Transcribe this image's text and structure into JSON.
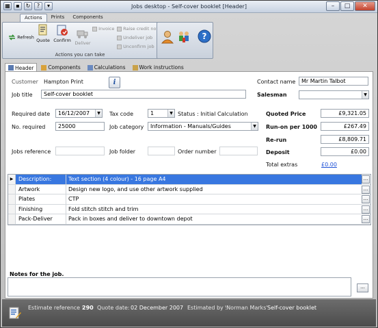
{
  "window": {
    "title": "Jobs desktop - Self-cover booklet [Header]"
  },
  "ribbon": {
    "tabs": [
      "Actions",
      "Prints",
      "Components"
    ],
    "buttons": {
      "refresh": "Refresh",
      "quote": "Quote",
      "confirm": "Confirm",
      "deliver": "Deliver",
      "invoice": "Invoice",
      "raise_credit_note": "Raise credit note",
      "undeliver_job": "Undeliver job",
      "unconfirm_job": "Unconfirm job"
    },
    "group_label": "Actions you can take"
  },
  "form_tabs": [
    "Header",
    "Components",
    "Calculations",
    "Work instructions"
  ],
  "header": {
    "customer_label": "Customer",
    "customer_value": "Hampton Print",
    "contact_label": "Contact name",
    "contact_value": "Mr Martin Talbot",
    "job_title_label": "Job title",
    "job_title_value": "Self-cover booklet",
    "salesman_label": "Salesman",
    "salesman_value": "",
    "required_date_label": "Required date",
    "required_date_value": "16/12/2007",
    "tax_code_label": "Tax code",
    "tax_code_value": "1",
    "status_text": "Status : Initial Calculation",
    "no_required_label": "No. required",
    "no_required_value": "25000",
    "job_category_label": "Job category",
    "job_category_value": "Information - Manuals/Guides",
    "jobs_reference_label": "Jobs reference",
    "jobs_reference_value": "",
    "job_folder_label": "Job folder",
    "job_folder_value": "",
    "order_number_label": "Order number",
    "order_number_value": "",
    "quoted_price_label": "Quoted Price",
    "quoted_price_value": "£9,321.05",
    "run_on_label": "Run-on per 1000",
    "run_on_value": "£267.49",
    "rerun_label": "Re-run",
    "rerun_value": "£8,809.71",
    "deposit_label": "Deposit",
    "deposit_value": "£0.00",
    "total_extras_label": "Total extras",
    "total_extras_value": "£0.00"
  },
  "grid": [
    {
      "caption": "Description:",
      "value": "Text section (4 colour) - 16 page A4"
    },
    {
      "caption": "Artwork",
      "value": "Design new logo, and use other artwork supplied"
    },
    {
      "caption": "Plates",
      "value": "CTP"
    },
    {
      "caption": "Finishing",
      "value": "Fold stitch stitch and trim"
    },
    {
      "caption": "Pack-Deliver",
      "value": "Pack in boxes and deliver to downtown depot"
    }
  ],
  "notes": {
    "label": "Notes for the job.",
    "value": "",
    "button": "..."
  },
  "status": {
    "estimate_label": "Estimate reference :",
    "estimate_value": "290",
    "quote_date_label": "Quote date:",
    "quote_date_value": "02 December 2007",
    "estimated_by_label": "Estimated by :",
    "estimated_by_value": "'Norman Marks'",
    "job_name": "Self-cover booklet"
  },
  "colors": {
    "selection": "#3877e0",
    "link": "#1c4fd6",
    "statusbar": "#5a5a5a"
  }
}
